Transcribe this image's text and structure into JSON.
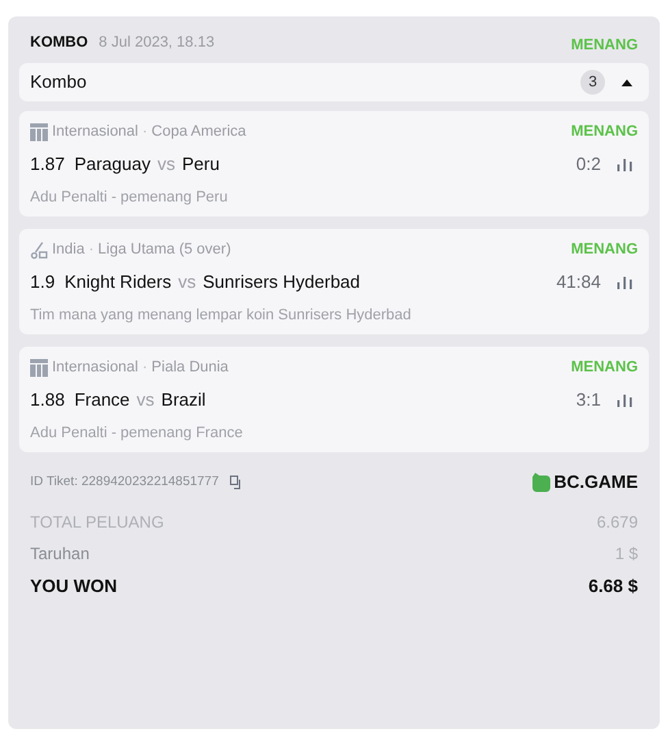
{
  "header": {
    "type": "KOMBO",
    "date": "8 Jul 2023, 18.13",
    "status": "MENANG"
  },
  "combo": {
    "label": "Kombo",
    "count": "3",
    "expanded": true
  },
  "bets": [
    {
      "kind": "football",
      "region": "Internasional",
      "separator": "·",
      "league": "Copa America",
      "status": "MENANG",
      "odds": "1.87",
      "home": "Paraguay",
      "vs": "vs",
      "away": "Peru",
      "score": "0:2",
      "market": "Adu Penalti - pemenang Peru"
    },
    {
      "kind": "cricket",
      "region": "India",
      "separator": "·",
      "league": "Liga Utama (5 over)",
      "status": "MENANG",
      "odds": "1.9",
      "home": "Knight Riders",
      "vs": "vs",
      "away": "Sunrisers Hyderbad",
      "score": "41:84",
      "market": "Tim mana yang menang lempar koin Sunrisers Hyderbad"
    },
    {
      "kind": "football",
      "region": "Internasional",
      "separator": "·",
      "league": "Piala Dunia",
      "status": "MENANG",
      "odds": "1.88",
      "home": "France",
      "vs": "vs",
      "away": "Brazil",
      "score": "3:1",
      "market": "Adu Penalti - pemenang France"
    }
  ],
  "ticket": {
    "id": "ID Tiket: 2289420232214851777",
    "brand": "BC.GAME"
  },
  "summary": [
    {
      "kind": "muted",
      "label": "TOTAL PELUANG",
      "value": "6.679"
    },
    {
      "kind": "normal",
      "label": "Taruhan",
      "value": "1 $"
    },
    {
      "kind": "total",
      "label": "YOU WON",
      "value": "6.68 $"
    }
  ]
}
